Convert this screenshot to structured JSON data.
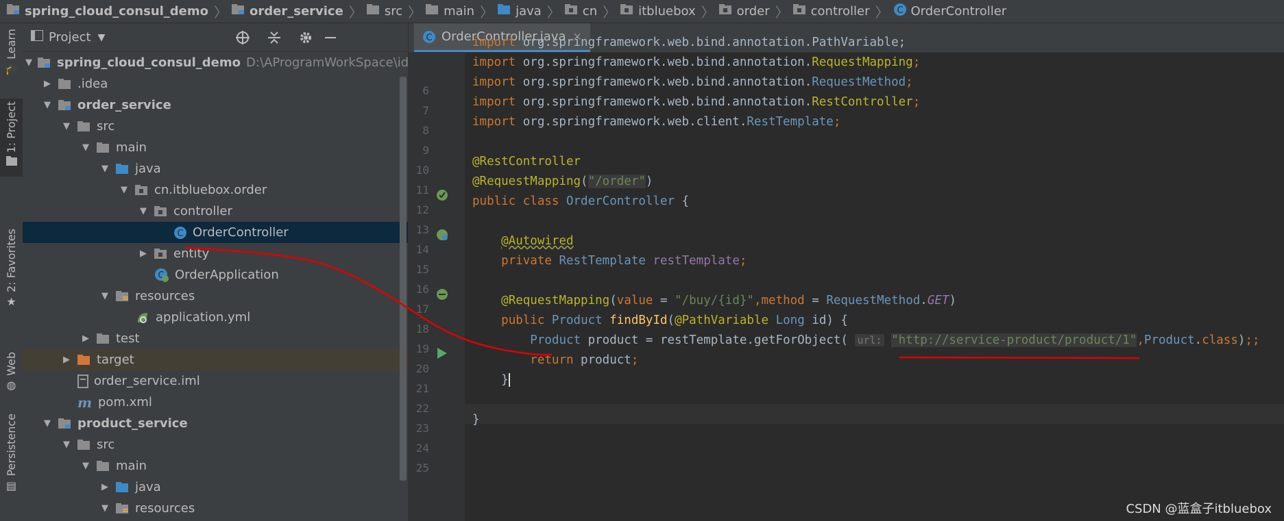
{
  "breadcrumb": [
    "spring_cloud_consul_demo",
    "order_service",
    "src",
    "main",
    "java",
    "cn",
    "itbluebox",
    "order",
    "controller",
    "OrderController"
  ],
  "toolstrip": {
    "learn": "Learn",
    "project": "1: Project",
    "favorites": "2: Favorites",
    "web": "Web",
    "persistence": "Persistence"
  },
  "project": {
    "title": "Project",
    "tree": [
      {
        "label": "spring_cloud_consul_demo",
        "path": "D:\\AProgramWorkSpace\\idea\\te"
      },
      {
        "label": ".idea"
      },
      {
        "label": "order_service"
      },
      {
        "label": "src"
      },
      {
        "label": "main"
      },
      {
        "label": "java"
      },
      {
        "label": "cn.itbluebox.order"
      },
      {
        "label": "controller"
      },
      {
        "label": "OrderController"
      },
      {
        "label": "entity"
      },
      {
        "label": "OrderApplication"
      },
      {
        "label": "resources"
      },
      {
        "label": "application.yml"
      },
      {
        "label": "test"
      },
      {
        "label": "target"
      },
      {
        "label": "order_service.iml"
      },
      {
        "label": "pom.xml"
      },
      {
        "label": "product_service"
      },
      {
        "label": "src"
      },
      {
        "label": "main"
      },
      {
        "label": "java"
      },
      {
        "label": "resources"
      }
    ]
  },
  "editor": {
    "tab": "OrderController.java",
    "line_numbers": [
      "6",
      "7",
      "8",
      "9",
      "10",
      "11",
      "12",
      "13",
      "14",
      "15",
      "16",
      "17",
      "18",
      "19",
      "20",
      "21",
      "22",
      "23",
      "24",
      "25"
    ],
    "url_hint": "url:",
    "url": "\"http://service-product/product/1\""
  },
  "watermark": "CSDN @蓝盒子itbluebox",
  "colors": {
    "accent": "#4a88c7",
    "keyword": "#cc7832",
    "annotation": "#bbb529",
    "string": "#6a8759",
    "type": "#6897bb",
    "red_mark": "#e00000"
  }
}
